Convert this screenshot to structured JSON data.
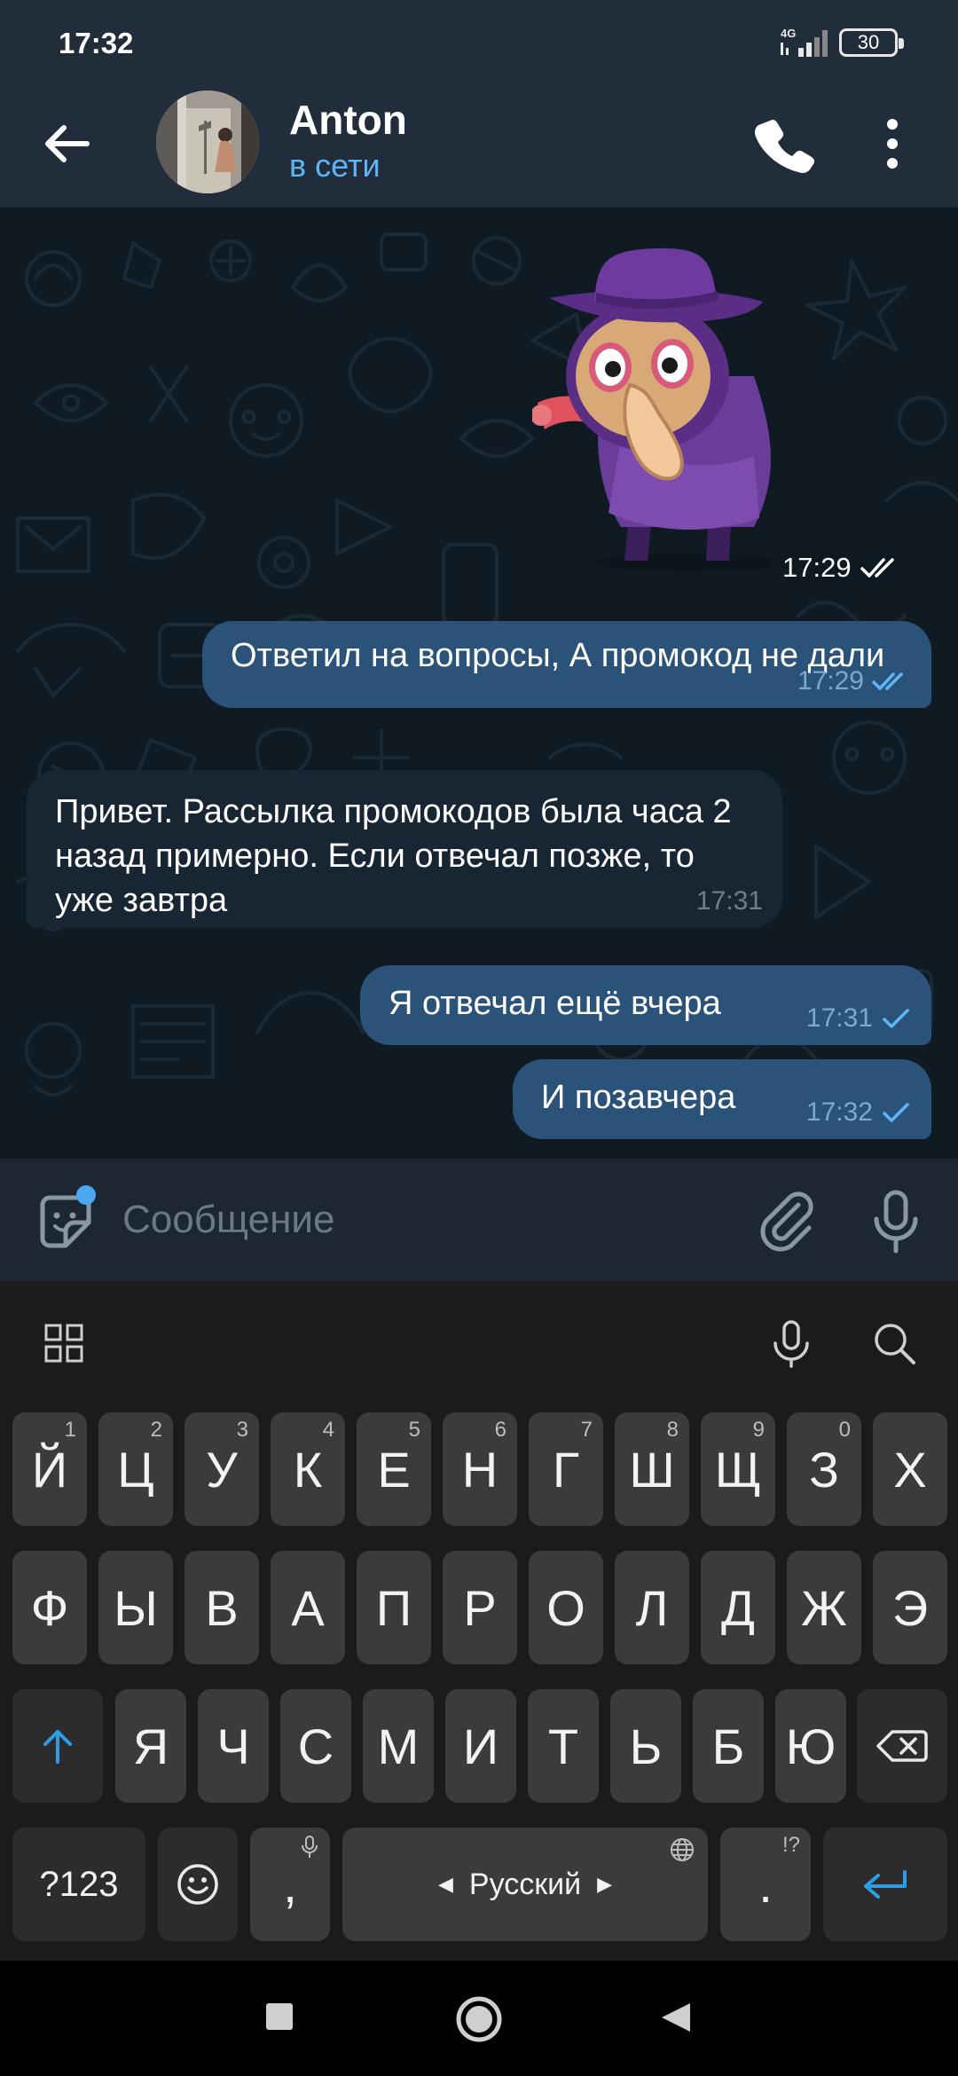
{
  "status_bar": {
    "time": "17:32",
    "network": "4G",
    "battery": "30"
  },
  "header": {
    "name": "Anton",
    "status": "в сети"
  },
  "sticker": {
    "time": "17:29"
  },
  "messages": [
    {
      "dir": "out",
      "text": "Ответил на вопросы, А промокод не дали",
      "time": "17:29",
      "status": "read"
    },
    {
      "dir": "in",
      "text": "Привет. Рассылка промокодов была часа 2 назад примерно. Если отвечал позже, то уже завтра",
      "time": "17:31"
    },
    {
      "dir": "out",
      "text": "Я отвечал ещё вчера",
      "time": "17:31",
      "status": "sent"
    },
    {
      "dir": "out",
      "text": "И позавчера",
      "time": "17:32",
      "status": "sent"
    }
  ],
  "input": {
    "placeholder": "Сообщение"
  },
  "keyboard": {
    "row1": [
      {
        "label": "Й",
        "hint": "1"
      },
      {
        "label": "Ц",
        "hint": "2"
      },
      {
        "label": "У",
        "hint": "3"
      },
      {
        "label": "К",
        "hint": "4"
      },
      {
        "label": "Е",
        "hint": "5"
      },
      {
        "label": "Н",
        "hint": "6"
      },
      {
        "label": "Г",
        "hint": "7"
      },
      {
        "label": "Ш",
        "hint": "8"
      },
      {
        "label": "Щ",
        "hint": "9"
      },
      {
        "label": "З",
        "hint": "0"
      },
      {
        "label": "Х",
        "hint": ""
      }
    ],
    "row2": [
      "Ф",
      "Ы",
      "В",
      "А",
      "П",
      "Р",
      "О",
      "Л",
      "Д",
      "Ж",
      "Э"
    ],
    "row3": [
      "Я",
      "Ч",
      "С",
      "М",
      "И",
      "Т",
      "Ь",
      "Б",
      "Ю"
    ],
    "symbols_label": "?123",
    "comma": ",",
    "space_label": "Русский",
    "period": ".",
    "period_hint": "!?"
  },
  "colors": {
    "header_bg": "#212d3b",
    "chat_bg": "#0f1a23",
    "bubble_out": "#2b5278",
    "bubble_in": "#182533",
    "accent": "#5eb5f7"
  }
}
